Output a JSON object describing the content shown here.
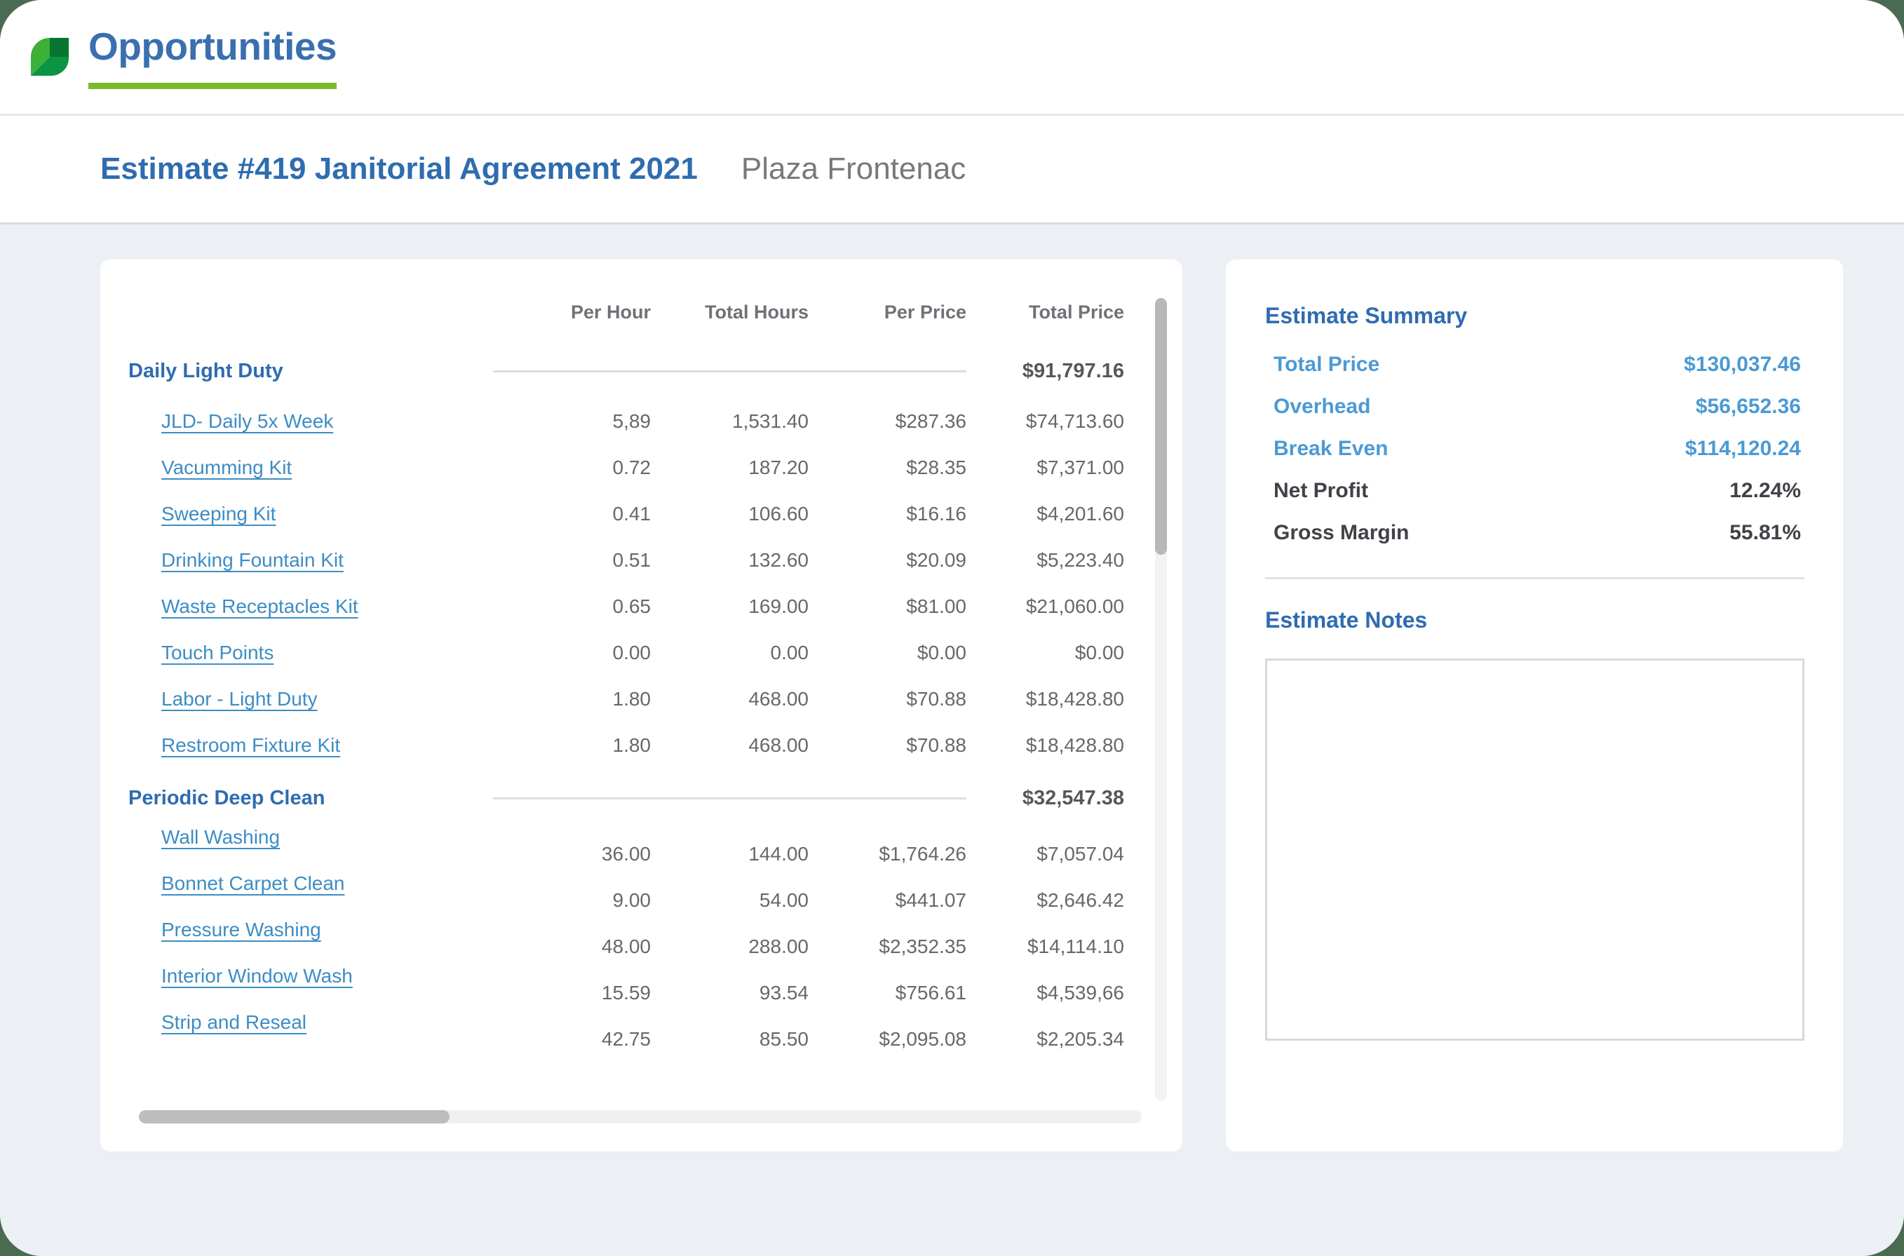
{
  "header": {
    "logo_icon": "leaf-icon",
    "title": "Opportunities",
    "accent_green": "#7ab929",
    "title_color": "#3a6fb0"
  },
  "sub_header": {
    "estimate_title": "Estimate #419 Janitorial Agreement 2021",
    "client_name": "Plaza Frontenac"
  },
  "line_items": {
    "columns": [
      "",
      "Per Hour",
      "Total Hours",
      "Per Price",
      "Total Price"
    ],
    "groups": [
      {
        "name": "Daily Light Duty",
        "total": "$91,797.16",
        "offset_labels": false,
        "rows": [
          {
            "name": "JLD- Daily 5x Week",
            "per_hour": "5,89",
            "total_hours": "1,531.40",
            "per_price": "$287.36",
            "total_price": "$74,713.60"
          },
          {
            "name": "Vacumming Kit",
            "per_hour": "0.72",
            "total_hours": "187.20",
            "per_price": "$28.35",
            "total_price": "$7,371.00"
          },
          {
            "name": "Sweeping Kit",
            "per_hour": "0.41",
            "total_hours": "106.60",
            "per_price": "$16.16",
            "total_price": "$4,201.60"
          },
          {
            "name": "Drinking Fountain Kit",
            "per_hour": "0.51",
            "total_hours": "132.60",
            "per_price": "$20.09",
            "total_price": "$5,223.40"
          },
          {
            "name": "Waste Receptacles Kit",
            "per_hour": "0.65",
            "total_hours": "169.00",
            "per_price": "$81.00",
            "total_price": "$21,060.00"
          },
          {
            "name": "Touch Points",
            "per_hour": "0.00",
            "total_hours": "0.00",
            "per_price": "$0.00",
            "total_price": "$0.00"
          },
          {
            "name": "Labor - Light Duty",
            "per_hour": "1.80",
            "total_hours": "468.00",
            "per_price": "$70.88",
            "total_price": "$18,428.80"
          },
          {
            "name": "Restroom Fixture Kit",
            "per_hour": "1.80",
            "total_hours": "468.00",
            "per_price": "$70.88",
            "total_price": "$18,428.80"
          }
        ]
      },
      {
        "name": "Periodic Deep Clean",
        "total": "$32,547.38",
        "offset_labels": true,
        "rows": [
          {
            "name": "Wall Washing",
            "per_hour": "36.00",
            "total_hours": "144.00",
            "per_price": "$1,764.26",
            "total_price": "$7,057.04"
          },
          {
            "name": "Bonnet Carpet Clean",
            "per_hour": "9.00",
            "total_hours": "54.00",
            "per_price": "$441.07",
            "total_price": "$2,646.42"
          },
          {
            "name": "Pressure Washing",
            "per_hour": "48.00",
            "total_hours": "288.00",
            "per_price": "$2,352.35",
            "total_price": "$14,114.10"
          },
          {
            "name": "Interior Window Wash",
            "per_hour": "15.59",
            "total_hours": "93.54",
            "per_price": "$756.61",
            "total_price": "$4,539,66"
          },
          {
            "name": "Strip and Reseal",
            "per_hour": "42.75",
            "total_hours": "85.50",
            "per_price": "$2,095.08",
            "total_price": "$2,205.34"
          }
        ]
      }
    ]
  },
  "summary": {
    "heading": "Estimate Summary",
    "rows": [
      {
        "label": "Total Price",
        "value": "$130,037.46",
        "style": "accent"
      },
      {
        "label": "Overhead",
        "value": "$56,652.36",
        "style": "accent"
      },
      {
        "label": "Break Even",
        "value": "$114,120.24",
        "style": "accent"
      },
      {
        "label": "Net Profit",
        "value": "12.24%",
        "style": "plain"
      },
      {
        "label": "Gross Margin",
        "value": "55.81%",
        "style": "plain"
      }
    ]
  },
  "notes": {
    "heading": "Estimate Notes",
    "value": "",
    "placeholder": ""
  },
  "scrollbars": {
    "vertical_thumb_pct": 32,
    "horizontal_thumb_pct": 31
  }
}
